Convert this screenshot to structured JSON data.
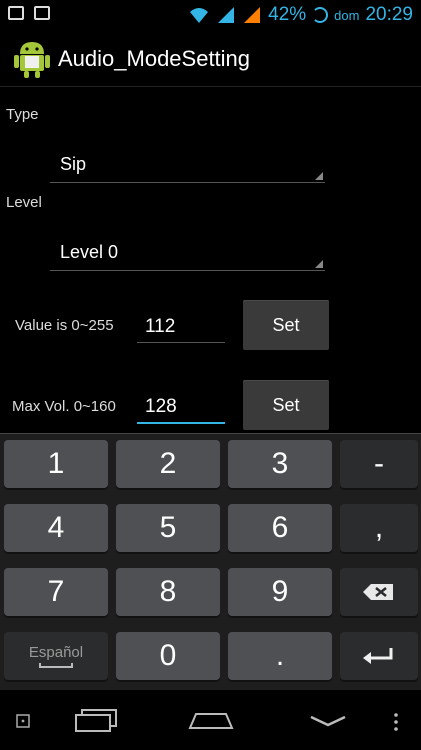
{
  "status": {
    "battery": "42%",
    "day": "dom",
    "time": "20:29"
  },
  "app": {
    "title": "Audio_ModeSetting"
  },
  "form": {
    "type_label": "Type",
    "type_value": "Sip",
    "level_label": "Level",
    "level_value": "Level 0",
    "value_label": "Value is 0~255",
    "value_input": "112",
    "max_label": "Max Vol. 0~160",
    "max_input": "128",
    "set_label": "Set"
  },
  "keyboard": {
    "rows": [
      [
        "1",
        "2",
        "3",
        "-"
      ],
      [
        "4",
        "5",
        "6",
        ","
      ],
      [
        "7",
        "8",
        "9",
        "backspace-icon"
      ],
      [
        "Español",
        "0",
        ".",
        "enter-icon"
      ]
    ]
  }
}
